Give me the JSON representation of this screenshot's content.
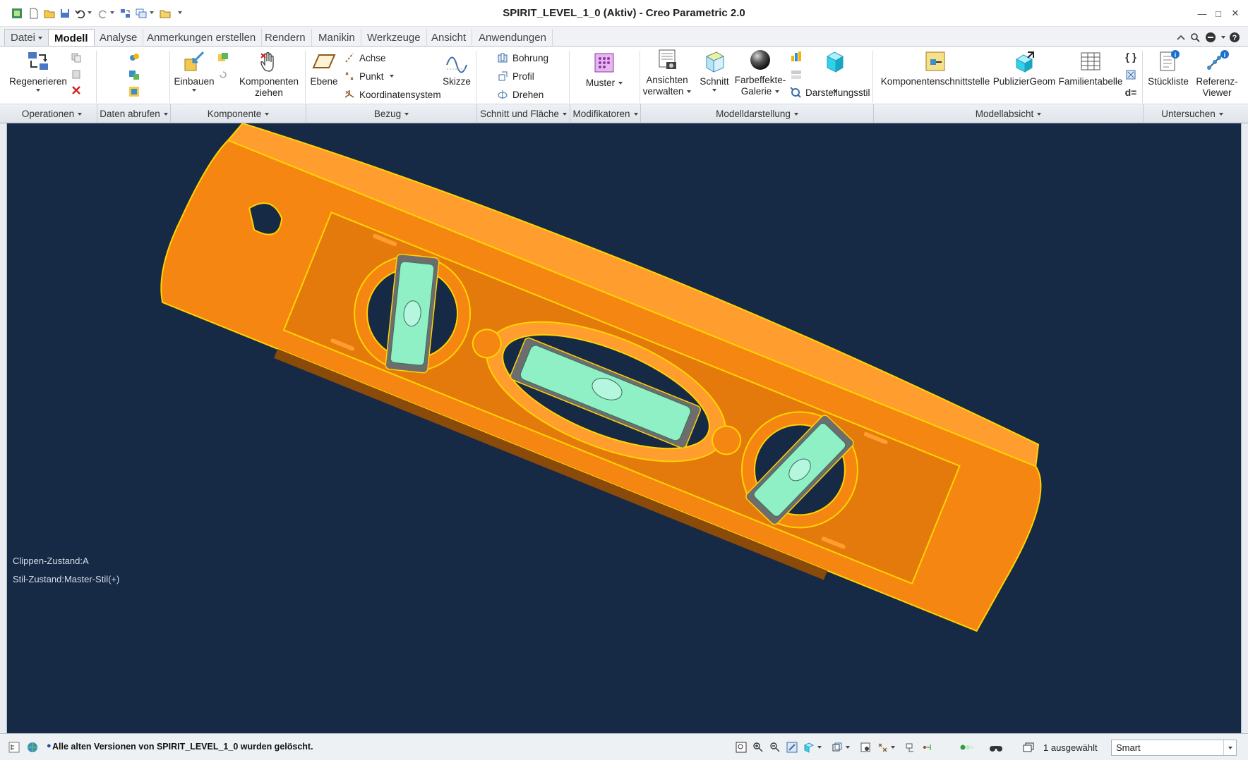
{
  "window": {
    "title": "SPIRIT_LEVEL_1_0 (Aktiv) - Creo Parametric 2.0"
  },
  "tabs": [
    {
      "label": "Datei",
      "has_dropdown": true
    },
    {
      "label": "Modell",
      "active": true
    },
    {
      "label": "Analyse"
    },
    {
      "label": "Anmerkungen erstellen"
    },
    {
      "label": "Rendern"
    },
    {
      "label": "Manikin"
    },
    {
      "label": "Werkzeuge"
    },
    {
      "label": "Ansicht"
    },
    {
      "label": "Anwendungen"
    }
  ],
  "ribbon": {
    "regenerieren": "Regenerieren",
    "einbauen": "Einbauen",
    "komponenten_ziehen_1": "Komponenten",
    "komponenten_ziehen_2": "ziehen",
    "ebene": "Ebene",
    "achse": "Achse",
    "punkt": "Punkt",
    "koordinatensystem": "Koordinatensystem",
    "skizze": "Skizze",
    "bohrung": "Bohrung",
    "profil": "Profil",
    "drehen": "Drehen",
    "muster": "Muster",
    "ansichten_verwalten_1": "Ansichten",
    "ansichten_verwalten_2": "verwalten",
    "schnitt": "Schnitt",
    "farbeffekte_1": "Farbeffekte-",
    "farbeffekte_2": "Galerie",
    "darstellungsstil": "Darstellungsstil",
    "komponentenschnittstelle": "Komponentenschnittstelle",
    "publiziergeom": "PublizierGeom",
    "familientabelle": "Familientabelle",
    "stueckliste": "Stückliste",
    "referenz_viewer_1": "Referenz-",
    "referenz_viewer_2": "Viewer"
  },
  "groups": [
    "Operationen",
    "Daten abrufen",
    "Komponente",
    "Bezug",
    "Schnitt und Fläche",
    "Modifikatoren",
    "Modelldarstellung",
    "Modellabsicht",
    "Untersuchen"
  ],
  "viewport": {
    "clip_state": "Clippen-Zustand:A",
    "style_state": "Stil-Zustand:Master-Stil(+)",
    "background_color": "#172a45",
    "model_color": "#f58612",
    "vial_color": "#8ff0c6",
    "edge_color": "#ffd400"
  },
  "statusbar": {
    "message": "Alle alten Versionen von SPIRIT_LEVEL_1_0 wurden gelöscht.",
    "selected": "1 ausgewählt",
    "filter": "Smart"
  }
}
